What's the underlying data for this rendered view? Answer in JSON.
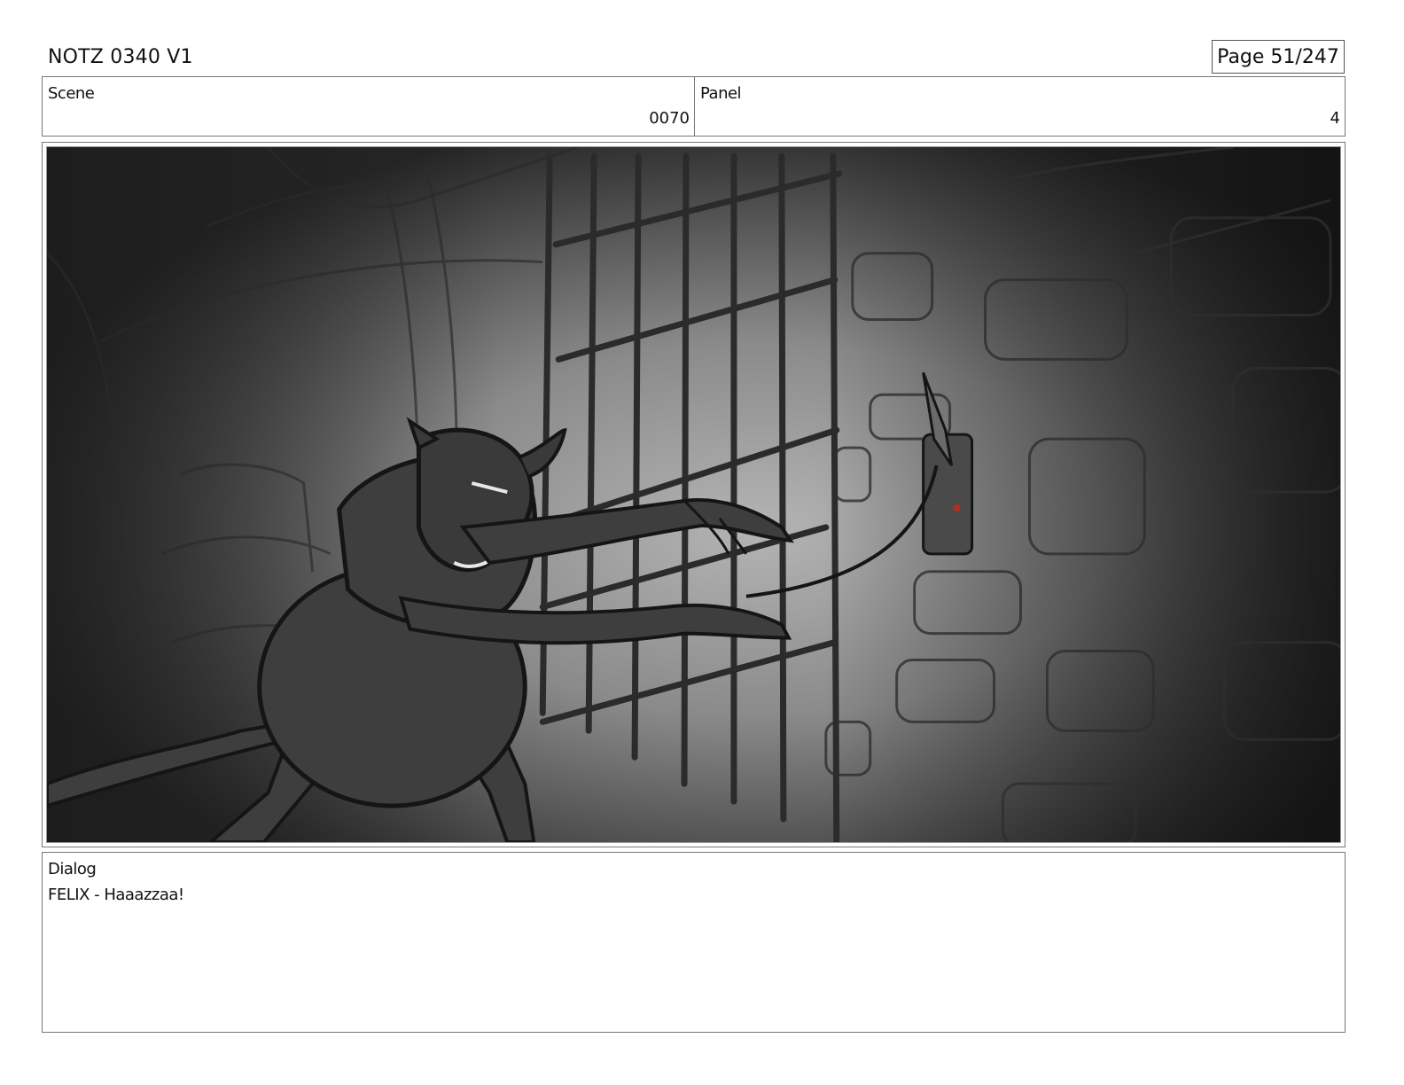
{
  "header": {
    "title": "NOTZ 0340 V1",
    "page": "Page  51/247"
  },
  "scene": {
    "label": "Scene",
    "value": "0070"
  },
  "panel": {
    "label": "Panel",
    "value": "4"
  },
  "dialog": {
    "label": "Dialog",
    "text": "FELIX - Haaazzaa!"
  },
  "illustration": {
    "icon": "storyboard-sketch-monkey-at-cage",
    "colors": {
      "dark": "#1c1c1c",
      "mid": "#5a5a5a",
      "light": "#a8a8a8",
      "figure": "#3e3e3e",
      "line": "#151515",
      "accent": "#b03020"
    }
  }
}
